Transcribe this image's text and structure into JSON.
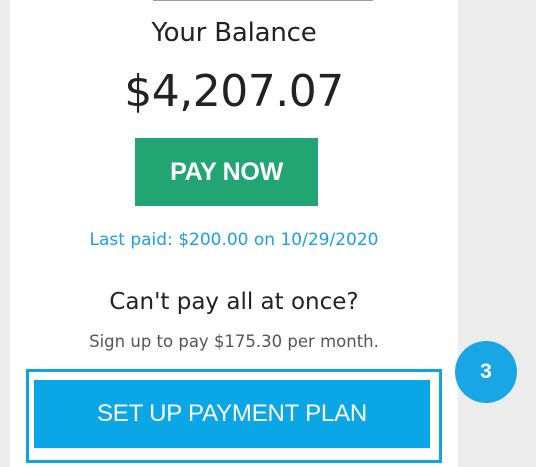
{
  "balance": {
    "label": "Your Balance",
    "amount": "$4,207.07"
  },
  "actions": {
    "pay_now_label": "PAY NOW",
    "last_paid_text": "Last paid: $200.00 on 10/29/2020"
  },
  "payment_plan": {
    "heading": "Can't pay all at once?",
    "subtext": "Sign up to pay $175.30 per month.",
    "button_label": "SET UP PAYMENT PLAN"
  },
  "annotation": {
    "step_number": "3"
  },
  "colors": {
    "pay_now_bg": "#22a573",
    "link_text": "#1ba1e2",
    "plan_button_bg": "#0aa6e6",
    "highlight_border": "#0fa3df",
    "badge_bg": "#1aa6e6"
  }
}
